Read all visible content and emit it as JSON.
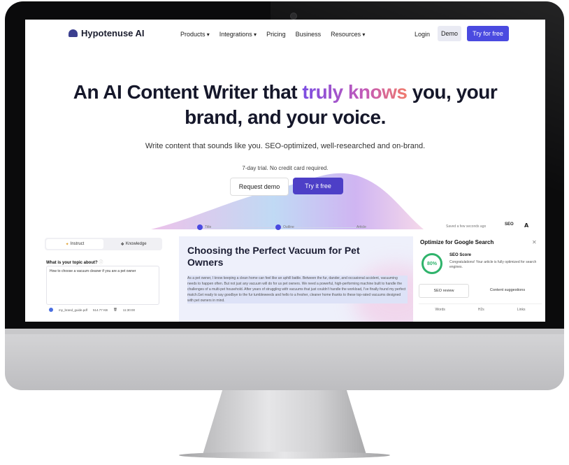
{
  "nav": {
    "logo": "Hypotenuse AI",
    "links": [
      "Products",
      "Integrations",
      "Pricing",
      "Business",
      "Resources"
    ],
    "login": "Login",
    "demo": "Demo",
    "try_free": "Try for free"
  },
  "hero": {
    "line1_start": "An AI Content Writer that ",
    "line1_highlight": "truly knows",
    "line1_end": " you, your",
    "line2": "brand, and your voice.",
    "subtitle": "Write content that sounds like you. SEO-optimized, well-researched and on-brand.",
    "trial_note": "7-day trial. No credit card required.",
    "request_demo": "Request demo",
    "try_it_free": "Try it free"
  },
  "editor": {
    "steps": [
      "Title",
      "Outline",
      "Article"
    ],
    "saved_status": "Saved a few seconds ago",
    "seo_label": "SEO",
    "left": {
      "tab_instruct": "Instruct",
      "tab_knowledge": "Knowledge",
      "topic_question": "What is your topic about?",
      "topic_value": "How to choose a vacuum cleaner if you are a pet owner",
      "file_name": "my_brand_guide.pdf",
      "file_size": "514.77 KB",
      "file_time": "11:30:00"
    },
    "article": {
      "title": "Choosing the Perfect Vacuum for Pet Owners",
      "body": "As a pet owner, I know keeping a clean home can feel like an uphill battle. Between the fur, dander, and occasional accident, vacuuming needs to happen often. But not just any vacuum will do for us pet owners. We need a powerful, high-performing machine built to handle the challenges of a multi-pet household. After years of struggling with vacuums that just couldn't handle the workload, I've finally found my perfect match.Get ready to say goodbye to the fur tumbleweeds and hello to a fresher, cleaner home thanks to these top-rated vacuums designed with pet owners in mind."
    },
    "right": {
      "title": "Optimize for Google Search",
      "seo_score_label": "SEO Score",
      "seo_score_value": "80%",
      "congrats": "Congratulations! Your article is fully optimized for search engines.",
      "seo_review": "SEO review",
      "content_suggestions": "Content suggestions",
      "stats": [
        "Words",
        "H2s",
        "Links"
      ]
    }
  },
  "colors": {
    "accent": "#4a4ae0",
    "highlight_start": "#7b4de2",
    "highlight_end": "#f07a6b",
    "score_green": "#2fb36b"
  }
}
